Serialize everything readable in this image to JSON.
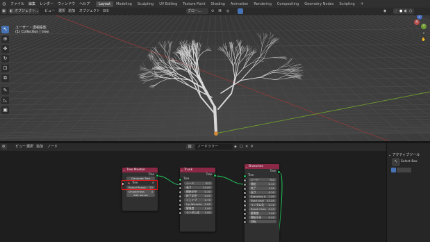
{
  "topbar": {
    "menus": [
      "ファイル",
      "編集",
      "レンダー",
      "ウィンドウ",
      "ヘルプ"
    ],
    "workspaces": [
      "Layout",
      "Modeling",
      "Sculpting",
      "UV Editing",
      "Texture Paint",
      "Shading",
      "Animation",
      "Rendering",
      "Compositing",
      "Geometry Nodes",
      "Scripting"
    ],
    "active_workspace": "Layout",
    "add_tab": "+"
  },
  "viewport_header": {
    "mode": "オブジェクト...",
    "menus": [
      "ビュー",
      "選択",
      "追加",
      "オブジェクト",
      "GIS"
    ],
    "transform_orientation": "グロー..."
  },
  "viewport": {
    "view_name": "ユーザー・透視投影",
    "collection_info": "(1) Collection | tree"
  },
  "node_header": {
    "menus": [
      "ビュー",
      "選択",
      "追加",
      "ノード"
    ],
    "tree_name": "ノードツリー"
  },
  "side_panel": {
    "title": "アクティブツール",
    "tool_name": "Select Box"
  },
  "nodes": {
    "tree_mesher": {
      "title": "Tree Mesher",
      "out_socket": "Tree",
      "generate_button": "Generate Tree",
      "tree_label": "Tree",
      "radial_label": "Radial Resolu",
      "radial_value": "32",
      "smooth_label": "smoothness",
      "smooth_value": "4",
      "add_leaves": "Add leaves"
    },
    "trunk": {
      "title": "Trunk",
      "out_socket": "Tree",
      "in_socket": "Tree",
      "rows": [
        {
          "l": "シード",
          "v": "523"
        },
        {
          "l": "長さ",
          "v": "14.00"
        },
        {
          "l": "開始半径",
          "v": "0.30"
        },
        {
          "l": "終了半径",
          "v": "0.05"
        },
        {
          "l": "シェイプ",
          "v": "0.70"
        },
        {
          "l": "Up Attractio",
          "v": "0.60"
        },
        {
          "l": "解像度",
          "v": "1.00"
        },
        {
          "l": "ランダム化",
          "v": "1.00"
        }
      ]
    },
    "branches": {
      "title": "Branches",
      "out_socket": "Tree",
      "in_socket": "Tree",
      "rows": [
        {
          "l": "シード",
          "v": "742"
        },
        {
          "l": "開始",
          "v": "0.10"
        },
        {
          "l": "終了",
          "v": "1.00"
        },
        {
          "l": "長さ",
          "v": "0.30"
        },
        {
          "l": "Branches d",
          "v": "2.00"
        },
        {
          "l": "Start angl",
          "v": "45.00"
        },
        {
          "l": "ランダム化",
          "v": "0.10"
        },
        {
          "l": "Break Chan",
          "v": "0.40"
        },
        {
          "l": "解像度",
          "v": "1.00"
        },
        {
          "l": "開始半径",
          "v": "0.40"
        },
        {
          "l": "回転",
          "v": ""
        }
      ]
    }
  },
  "colors": {
    "accent": "#4772b3",
    "node_header": "#8a2845",
    "socket_tree": "#22c55e",
    "highlight": "#e01818",
    "x_axis": "#9b3c3c",
    "y_axis": "#6e9a2f"
  }
}
